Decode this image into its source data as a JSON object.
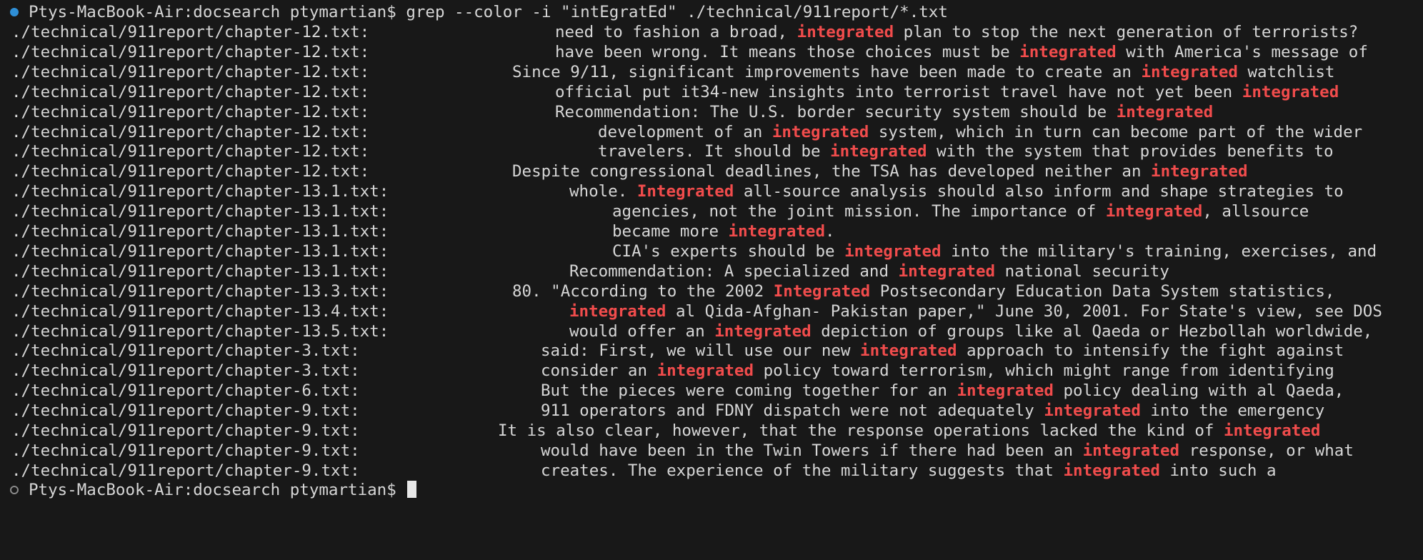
{
  "terminal": {
    "colors": {
      "background": "#181818",
      "text": "#d6d6d6",
      "highlight": "#f14c4c",
      "prompt_dot_success": "#2f8fd6"
    },
    "command_prompt": "Ptys-MacBook-Air:docsearch ptymartian$ ",
    "command": "grep --color -i \"intEgratEd\" ./technical/911report/*.txt",
    "final_prompt": "Ptys-MacBook-Air:docsearch ptymartian$ ",
    "results": [
      {
        "path": "./technical/911report/chapter-12.txt:",
        "indent": 0.39,
        "before": "need to fashion a broad, ",
        "match": "integrated",
        "after": " plan to stop the next generation of terrorists?"
      },
      {
        "path": "./technical/911report/chapter-12.txt:",
        "indent": 0.39,
        "before": "have been wrong. It means those choices must be ",
        "match": "integrated",
        "after": " with America's message of"
      },
      {
        "path": "./technical/911report/chapter-12.txt:",
        "indent": 0.36,
        "before": "Since 9/11, significant improvements have been made to create an ",
        "match": "integrated",
        "after": " watchlist"
      },
      {
        "path": "./technical/911report/chapter-12.txt:",
        "indent": 0.39,
        "before": "official put it34-new insights into terrorist travel have not yet been ",
        "match": "integrated",
        "after": ""
      },
      {
        "path": "./technical/911report/chapter-12.txt:",
        "indent": 0.39,
        "before": "Recommendation: The U.S. border security system should be ",
        "match": "integrated",
        "after": ""
      },
      {
        "path": "./technical/911report/chapter-12.txt:",
        "indent": 0.42,
        "before": "development of an ",
        "match": "integrated",
        "after": " system, which in turn can become part of the wider"
      },
      {
        "path": "./technical/911report/chapter-12.txt:",
        "indent": 0.42,
        "before": "travelers. It should be ",
        "match": "integrated",
        "after": " with the system that provides benefits to"
      },
      {
        "path": "./technical/911report/chapter-12.txt:",
        "indent": 0.36,
        "before": "Despite congressional deadlines, the TSA has developed neither an ",
        "match": "integrated",
        "after": ""
      },
      {
        "path": "./technical/911report/chapter-13.1.txt:",
        "indent": 0.4,
        "before": "whole. ",
        "match": "Integrated",
        "after": " all-source analysis should also inform and shape strategies to"
      },
      {
        "path": "./technical/911report/chapter-13.1.txt:",
        "indent": 0.43,
        "before": "agencies, not the joint mission. The importance of ",
        "match": "integrated",
        "after": ", allsource"
      },
      {
        "path": "./technical/911report/chapter-13.1.txt:",
        "indent": 0.43,
        "before": "became more ",
        "match": "integrated",
        "after": "."
      },
      {
        "path": "./technical/911report/chapter-13.1.txt:",
        "indent": 0.43,
        "before": "CIA's experts should be ",
        "match": "integrated",
        "after": " into the military's training, exercises, and"
      },
      {
        "path": "./technical/911report/chapter-13.1.txt:",
        "indent": 0.4,
        "before": "Recommendation: A specialized and ",
        "match": "integrated",
        "after": " national security"
      },
      {
        "path": "./technical/911report/chapter-13.3.txt:",
        "indent": 0.36,
        "before": "80. \"According to the 2002 ",
        "match": "Integrated",
        "after": " Postsecondary Education Data System statistics,"
      },
      {
        "path": "./technical/911report/chapter-13.4.txt:",
        "indent": 0.4,
        "before": "",
        "match": "integrated",
        "after": " al Qida-Afghan- Pakistan paper,\" June 30, 2001. For State's view, see DOS"
      },
      {
        "path": "./technical/911report/chapter-13.5.txt:",
        "indent": 0.4,
        "before": "would offer an ",
        "match": "integrated",
        "after": " depiction of groups like al Qaeda or Hezbollah worldwide,"
      },
      {
        "path": "./technical/911report/chapter-3.txt:",
        "indent": 0.38,
        "before": "said: First, we will use our new ",
        "match": "integrated",
        "after": " approach to intensify the fight against"
      },
      {
        "path": "./technical/911report/chapter-3.txt:",
        "indent": 0.38,
        "before": "consider an ",
        "match": "integrated",
        "after": " policy toward terrorism, which might range from identifying"
      },
      {
        "path": "./technical/911report/chapter-6.txt:",
        "indent": 0.38,
        "before": "But the pieces were coming together for an ",
        "match": "integrated",
        "after": " policy dealing with al Qaeda,"
      },
      {
        "path": "./technical/911report/chapter-9.txt:",
        "indent": 0.38,
        "before": "911 operators and FDNY dispatch were not adequately ",
        "match": "integrated",
        "after": " into the emergency"
      },
      {
        "path": "./technical/911report/chapter-9.txt:",
        "indent": 0.35,
        "before": "It is also clear, however, that the response operations lacked the kind of ",
        "match": "integrated",
        "after": ""
      },
      {
        "path": "./technical/911report/chapter-9.txt:",
        "indent": 0.38,
        "before": "would have been in the Twin Towers if there had been an ",
        "match": "integrated",
        "after": " response, or what"
      },
      {
        "path": "./technical/911report/chapter-9.txt:",
        "indent": 0.38,
        "before": "creates. The experience of the military suggests that ",
        "match": "integrated",
        "after": " into such a"
      }
    ]
  }
}
